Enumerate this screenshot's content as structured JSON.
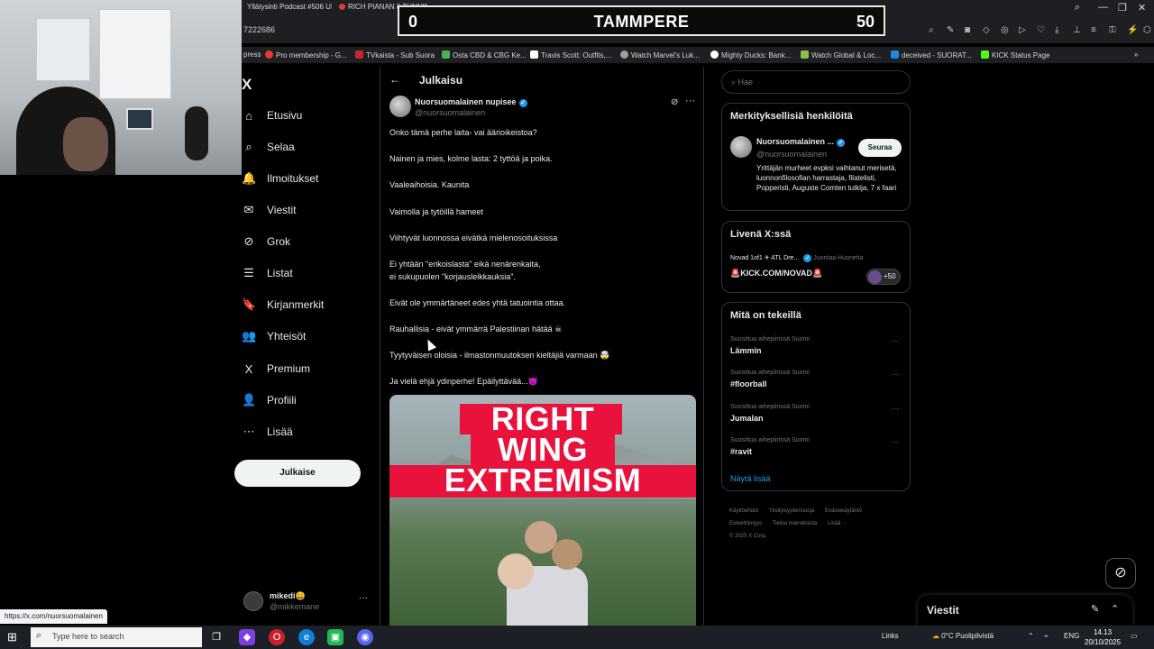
{
  "browser": {
    "tabs": [
      "Yllätysinti Podcast #506 UF...",
      "RICH PIANAN 8 TUNNIN..."
    ],
    "url_fragment": "7222686",
    "scoreboard": {
      "left": "0",
      "center": "TAMMPERE",
      "right": "50"
    },
    "bookmarks": [
      {
        "label": "press",
        "color": "#00000000"
      },
      {
        "label": "Pro membership - G...",
        "color": "#e53935"
      },
      {
        "label": "TVkaista - Sub Suora",
        "color": "#c62828"
      },
      {
        "label": "Osta CBD & CBG Ke...",
        "color": "#4caf50"
      },
      {
        "label": "Travis Scott: Outfits,...",
        "color": "#ffffff"
      },
      {
        "label": "Watch Marvel's Luk...",
        "color": "#9e9e9e"
      },
      {
        "label": "Mighty Ducks: Bank...",
        "color": "#ffffff"
      },
      {
        "label": "Watch Global & Loc...",
        "color": "#8bc34a"
      },
      {
        "label": "deceived - SUORAT...",
        "color": "#1e88e5"
      },
      {
        "label": "KICK Status Page",
        "color": "#53fc18"
      }
    ]
  },
  "nav": {
    "logo": "X",
    "items": [
      {
        "label": "Etusivu",
        "icon": "⌂"
      },
      {
        "label": "Selaa",
        "icon": "⌕"
      },
      {
        "label": "Ilmoitukset",
        "icon": "🔔"
      },
      {
        "label": "Viestit",
        "icon": "✉"
      },
      {
        "label": "Grok",
        "icon": "⊘"
      },
      {
        "label": "Listat",
        "icon": "☰"
      },
      {
        "label": "Kirjanmerkit",
        "icon": "🔖"
      },
      {
        "label": "Yhteisöt",
        "icon": "👥"
      },
      {
        "label": "Premium",
        "icon": "X"
      },
      {
        "label": "Profiili",
        "icon": "👤"
      },
      {
        "label": "Lisää",
        "icon": "⋯"
      }
    ],
    "post_button": "Julkaise",
    "account": {
      "name": "mikedi😀",
      "handle": "@mikkemane",
      "more": "···"
    }
  },
  "main": {
    "back": "←",
    "title": "Julkaisu",
    "author": {
      "name": "Nuorsuomalainen nupisee",
      "handle": "@nuorsuomalainen",
      "verified": "✓",
      "more": "···"
    },
    "lines": [
      {
        "text": "Onko tämä perhe laita- vai äärioikeistoa?"
      },
      {
        "text": "Nainen ja mies, kolme lasta: 2 tyttöä ja poika."
      },
      {
        "text": "Vaaleaihoisia. Kaunita"
      },
      {
        "text": "Vaimolla ja tytöillä hameet"
      },
      {
        "text": "Viihtyvät luonnossa eivätkä mielenosoituksissa"
      },
      {
        "text": "Ei yhtään \"erikoislasta\" eikä nenärenkaita,"
      },
      {
        "text": "ei sukupuolen \"korjausleikkauksia\"."
      },
      {
        "text": "Eivät ole ymmärtäneet edes yhtä tatuointia ottaa."
      },
      {
        "text": "Rauhallisia - eivät ymmärrä Palestiinan hätää ☠"
      },
      {
        "text": "Tyytyväisen oloisia - ilmastonmuutoksen kieltäjiä varmaan 🤯"
      },
      {
        "text": "Ja vielä ehjä ydinperhe! Epäilyttävää...😈"
      }
    ],
    "image": {
      "line1": "RIGHT",
      "line2": "WING",
      "line3": "EXTREMISM"
    }
  },
  "right": {
    "search_placeholder": "Hae",
    "who_to_follow": {
      "heading": "Merkityksellisiä henkilöitä",
      "name": "Nuorsuomalainen ...",
      "handle": "@nuorsuomalainen",
      "follow": "Seuraa",
      "bio": "Yrittäjän murheet evpksi vaihtanut merisetä, luonnonfilosofian harrastaja, filatelisti, Popperisti, Auguste Comten tutkija, 7 x faari"
    },
    "live": {
      "heading": "Livenä X:ssä",
      "row": "Novad 1of1 ✈ ATL Dre...",
      "host": "Juontaa Huonetta",
      "title": "🚨KICK.COM/NOVAD🚨",
      "count": "+50"
    },
    "trends": {
      "heading": "Mitä on tekeillä",
      "items": [
        {
          "context": "Suosittua aihepiirissä Suomi",
          "topic": "Lämmin"
        },
        {
          "context": "Suosittua aihepiirissä Suomi",
          "topic": "#floorball"
        },
        {
          "context": "Suosittua aihepiirissä Suomi",
          "topic": "Jumalan"
        },
        {
          "context": "Suosittua aihepiirissä Suomi",
          "topic": "#ravit"
        }
      ],
      "show_more": "Näytä lisää"
    },
    "footer": [
      "Käyttöehdot",
      "Yksityisyydensuoja",
      "Evästekäytäntö",
      "Esteettömyys",
      "Tietoa mainoksista",
      "Lisää ···",
      "© 2025 X Corp."
    ]
  },
  "messages_drawer": {
    "title": "Viestit"
  },
  "status_url": "https://x.com/nuorsuomalainen",
  "taskbar": {
    "search_placeholder": "Type here to search",
    "links": "Links",
    "weather": "0°C  Puolipilvistä",
    "lang": "ENG",
    "time": "14.13",
    "date": "20/10/2025"
  }
}
